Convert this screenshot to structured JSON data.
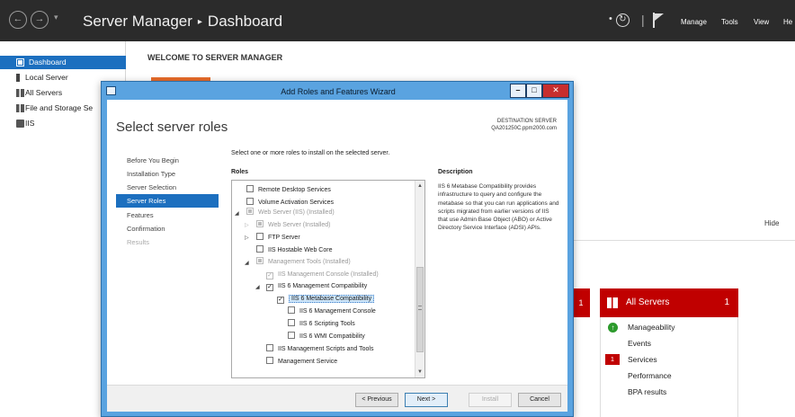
{
  "titlebar": {
    "title": "Server Manager",
    "separator": "▸",
    "page": "Dashboard",
    "menu": [
      "Manage",
      "Tools",
      "View",
      "He"
    ]
  },
  "sidebar": {
    "items": [
      {
        "label": "Dashboard",
        "icon": "dashboard-icon",
        "active": true
      },
      {
        "label": "Local Server",
        "icon": "local-server-icon"
      },
      {
        "label": "All Servers",
        "icon": "all-servers-icon"
      },
      {
        "label": "File and Storage Se",
        "icon": "storage-icon"
      },
      {
        "label": "IIS",
        "icon": "iis-icon"
      }
    ]
  },
  "dashboard": {
    "welcome": "WELCOME TO SERVER MANAGER",
    "hide": "Hide",
    "small_tile_count": "1",
    "all_servers": {
      "title": "All Servers",
      "count": "1",
      "rows": [
        "Manageability",
        "Events",
        "Services",
        "Performance",
        "BPA results"
      ],
      "services_badge": "1"
    }
  },
  "wizard": {
    "title": "Add Roles and Features Wizard",
    "heading": "Select server roles",
    "destination_label": "DESTINATION SERVER",
    "destination_server": "QA201250C.ppm2000.com",
    "steps": [
      "Before You Begin",
      "Installation Type",
      "Server Selection",
      "Server Roles",
      "Features",
      "Confirmation",
      "Results"
    ],
    "instruction": "Select one or more roles to install on the selected server.",
    "roles_label": "Roles",
    "description_label": "Description",
    "description": "IIS 6 Metabase Compatibility provides infrastructure to query and configure the metabase so that you can run applications and scripts migrated from earlier versions of IIS that use Admin Base Object (ABO) or Active Directory Service Interface (ADSI) APIs.",
    "roles": [
      {
        "label": "Remote Desktop Services"
      },
      {
        "label": "Volume Activation Services"
      },
      {
        "label": "Web Server (IIS) (Installed)"
      },
      {
        "label": "Web Server (Installed)"
      },
      {
        "label": "FTP Server"
      },
      {
        "label": "IIS Hostable Web Core"
      },
      {
        "label": "Management Tools (Installed)"
      },
      {
        "label": "IIS Management Console (Installed)"
      },
      {
        "label": "IIS 6 Management Compatibility"
      },
      {
        "label": "IIS 6 Metabase Compatibility"
      },
      {
        "label": "IIS 6 Management Console"
      },
      {
        "label": "IIS 6 Scripting Tools"
      },
      {
        "label": "IIS 6 WMI Compatibility"
      },
      {
        "label": "IIS Management Scripts and Tools"
      },
      {
        "label": "Management Service"
      }
    ],
    "buttons": {
      "previous": "< Previous",
      "next": "Next >",
      "install": "Install",
      "cancel": "Cancel"
    }
  }
}
